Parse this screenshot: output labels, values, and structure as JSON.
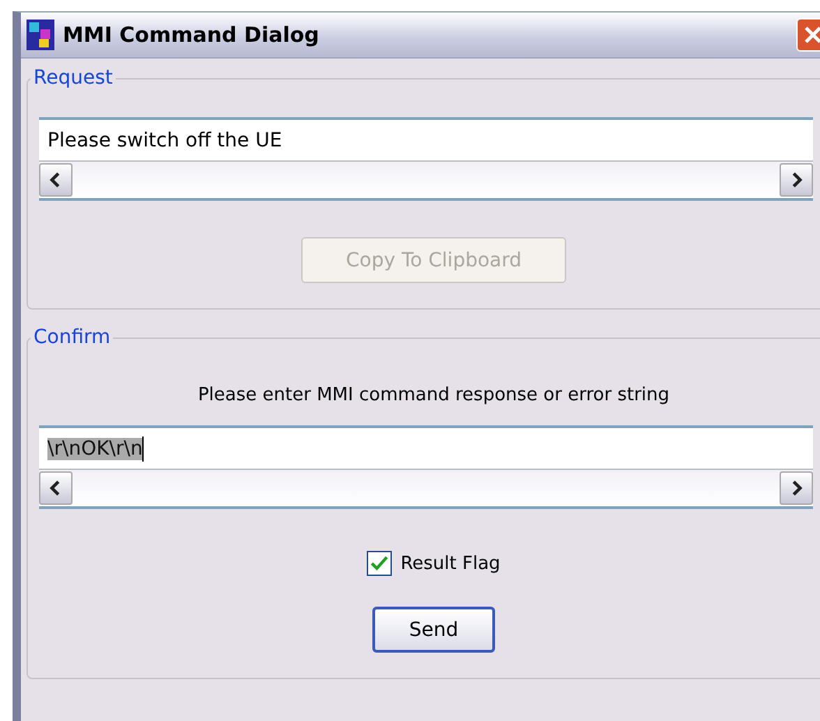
{
  "window": {
    "title": "MMI Command Dialog"
  },
  "request": {
    "legend": "Request",
    "value": "Please switch off the UE",
    "button": {
      "label": "Copy To Clipboard",
      "disabled": true
    }
  },
  "confirm": {
    "legend": "Confirm",
    "prompt": "Please enter MMI command response or error string",
    "value": "\\r\\nOK\\r\\n",
    "value_selected": true,
    "checkbox": {
      "label": "Result Flag",
      "checked": true
    },
    "button": {
      "label": "Send",
      "disabled": false
    }
  }
}
